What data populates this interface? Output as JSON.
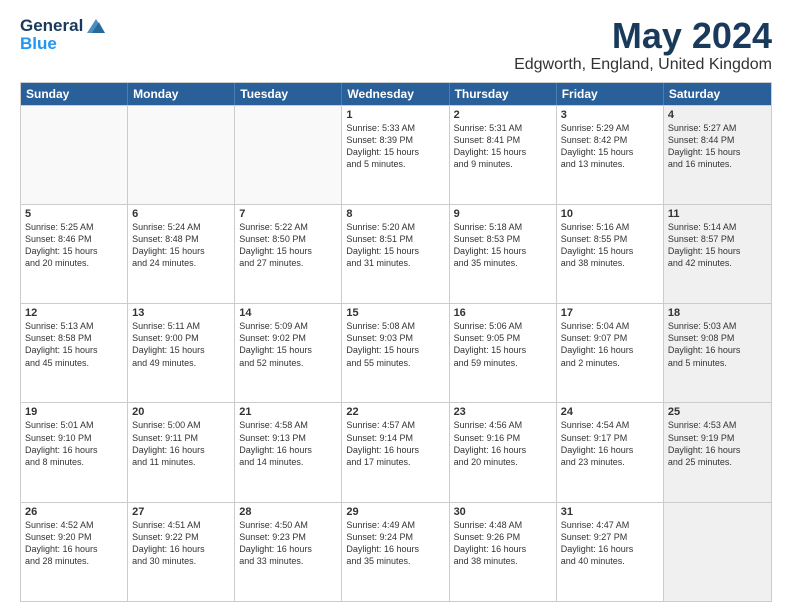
{
  "header": {
    "logo_line1": "General",
    "logo_line2": "Blue",
    "title": "May 2024",
    "subtitle": "Edgworth, England, United Kingdom"
  },
  "weekdays": [
    "Sunday",
    "Monday",
    "Tuesday",
    "Wednesday",
    "Thursday",
    "Friday",
    "Saturday"
  ],
  "rows": [
    [
      {
        "day": "",
        "text": "",
        "empty": true
      },
      {
        "day": "",
        "text": "",
        "empty": true
      },
      {
        "day": "",
        "text": "",
        "empty": true
      },
      {
        "day": "1",
        "text": "Sunrise: 5:33 AM\nSunset: 8:39 PM\nDaylight: 15 hours\nand 5 minutes.",
        "empty": false
      },
      {
        "day": "2",
        "text": "Sunrise: 5:31 AM\nSunset: 8:41 PM\nDaylight: 15 hours\nand 9 minutes.",
        "empty": false
      },
      {
        "day": "3",
        "text": "Sunrise: 5:29 AM\nSunset: 8:42 PM\nDaylight: 15 hours\nand 13 minutes.",
        "empty": false
      },
      {
        "day": "4",
        "text": "Sunrise: 5:27 AM\nSunset: 8:44 PM\nDaylight: 15 hours\nand 16 minutes.",
        "empty": false,
        "shaded": true
      }
    ],
    [
      {
        "day": "5",
        "text": "Sunrise: 5:25 AM\nSunset: 8:46 PM\nDaylight: 15 hours\nand 20 minutes.",
        "empty": false
      },
      {
        "day": "6",
        "text": "Sunrise: 5:24 AM\nSunset: 8:48 PM\nDaylight: 15 hours\nand 24 minutes.",
        "empty": false
      },
      {
        "day": "7",
        "text": "Sunrise: 5:22 AM\nSunset: 8:50 PM\nDaylight: 15 hours\nand 27 minutes.",
        "empty": false
      },
      {
        "day": "8",
        "text": "Sunrise: 5:20 AM\nSunset: 8:51 PM\nDaylight: 15 hours\nand 31 minutes.",
        "empty": false
      },
      {
        "day": "9",
        "text": "Sunrise: 5:18 AM\nSunset: 8:53 PM\nDaylight: 15 hours\nand 35 minutes.",
        "empty": false
      },
      {
        "day": "10",
        "text": "Sunrise: 5:16 AM\nSunset: 8:55 PM\nDaylight: 15 hours\nand 38 minutes.",
        "empty": false
      },
      {
        "day": "11",
        "text": "Sunrise: 5:14 AM\nSunset: 8:57 PM\nDaylight: 15 hours\nand 42 minutes.",
        "empty": false,
        "shaded": true
      }
    ],
    [
      {
        "day": "12",
        "text": "Sunrise: 5:13 AM\nSunset: 8:58 PM\nDaylight: 15 hours\nand 45 minutes.",
        "empty": false
      },
      {
        "day": "13",
        "text": "Sunrise: 5:11 AM\nSunset: 9:00 PM\nDaylight: 15 hours\nand 49 minutes.",
        "empty": false
      },
      {
        "day": "14",
        "text": "Sunrise: 5:09 AM\nSunset: 9:02 PM\nDaylight: 15 hours\nand 52 minutes.",
        "empty": false
      },
      {
        "day": "15",
        "text": "Sunrise: 5:08 AM\nSunset: 9:03 PM\nDaylight: 15 hours\nand 55 minutes.",
        "empty": false
      },
      {
        "day": "16",
        "text": "Sunrise: 5:06 AM\nSunset: 9:05 PM\nDaylight: 15 hours\nand 59 minutes.",
        "empty": false
      },
      {
        "day": "17",
        "text": "Sunrise: 5:04 AM\nSunset: 9:07 PM\nDaylight: 16 hours\nand 2 minutes.",
        "empty": false
      },
      {
        "day": "18",
        "text": "Sunrise: 5:03 AM\nSunset: 9:08 PM\nDaylight: 16 hours\nand 5 minutes.",
        "empty": false,
        "shaded": true
      }
    ],
    [
      {
        "day": "19",
        "text": "Sunrise: 5:01 AM\nSunset: 9:10 PM\nDaylight: 16 hours\nand 8 minutes.",
        "empty": false
      },
      {
        "day": "20",
        "text": "Sunrise: 5:00 AM\nSunset: 9:11 PM\nDaylight: 16 hours\nand 11 minutes.",
        "empty": false
      },
      {
        "day": "21",
        "text": "Sunrise: 4:58 AM\nSunset: 9:13 PM\nDaylight: 16 hours\nand 14 minutes.",
        "empty": false
      },
      {
        "day": "22",
        "text": "Sunrise: 4:57 AM\nSunset: 9:14 PM\nDaylight: 16 hours\nand 17 minutes.",
        "empty": false
      },
      {
        "day": "23",
        "text": "Sunrise: 4:56 AM\nSunset: 9:16 PM\nDaylight: 16 hours\nand 20 minutes.",
        "empty": false
      },
      {
        "day": "24",
        "text": "Sunrise: 4:54 AM\nSunset: 9:17 PM\nDaylight: 16 hours\nand 23 minutes.",
        "empty": false
      },
      {
        "day": "25",
        "text": "Sunrise: 4:53 AM\nSunset: 9:19 PM\nDaylight: 16 hours\nand 25 minutes.",
        "empty": false,
        "shaded": true
      }
    ],
    [
      {
        "day": "26",
        "text": "Sunrise: 4:52 AM\nSunset: 9:20 PM\nDaylight: 16 hours\nand 28 minutes.",
        "empty": false
      },
      {
        "day": "27",
        "text": "Sunrise: 4:51 AM\nSunset: 9:22 PM\nDaylight: 16 hours\nand 30 minutes.",
        "empty": false
      },
      {
        "day": "28",
        "text": "Sunrise: 4:50 AM\nSunset: 9:23 PM\nDaylight: 16 hours\nand 33 minutes.",
        "empty": false
      },
      {
        "day": "29",
        "text": "Sunrise: 4:49 AM\nSunset: 9:24 PM\nDaylight: 16 hours\nand 35 minutes.",
        "empty": false
      },
      {
        "day": "30",
        "text": "Sunrise: 4:48 AM\nSunset: 9:26 PM\nDaylight: 16 hours\nand 38 minutes.",
        "empty": false
      },
      {
        "day": "31",
        "text": "Sunrise: 4:47 AM\nSunset: 9:27 PM\nDaylight: 16 hours\nand 40 minutes.",
        "empty": false
      },
      {
        "day": "",
        "text": "",
        "empty": true,
        "shaded": true
      }
    ]
  ]
}
